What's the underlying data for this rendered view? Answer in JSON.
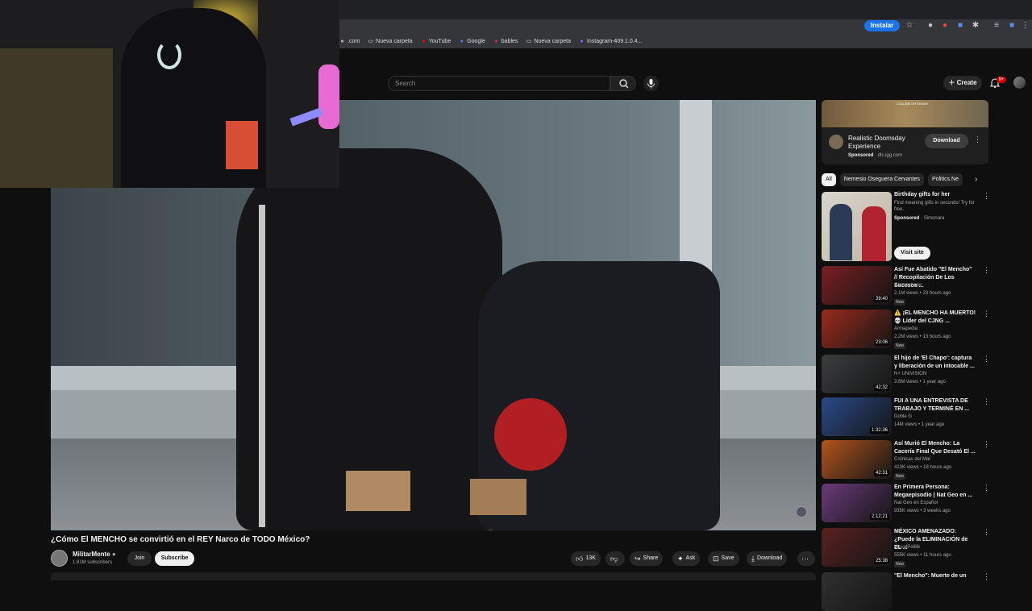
{
  "browser": {
    "install_label": "Instalar",
    "bookmarks": [
      {
        "label": ".com",
        "icon": "link-icon",
        "color": "#bbbbbb"
      },
      {
        "label": "Nueva carpeta",
        "icon": "folder-icon",
        "color": "#dddddd"
      },
      {
        "label": "YouTube",
        "icon": "youtube-icon",
        "color": "#ff0000"
      },
      {
        "label": "Google",
        "icon": "google-icon",
        "color": "#4285f4"
      },
      {
        "label": "bables",
        "icon": "site-icon",
        "color": "#e0245e"
      },
      {
        "label": "Nueva carpeta",
        "icon": "folder-icon",
        "color": "#dddddd"
      },
      {
        "label": "Instagram-409.1.0.4...",
        "icon": "instagram-icon",
        "color": "#8a5cf6"
      }
    ]
  },
  "masthead": {
    "search_placeholder": "Search",
    "create_label": "Create",
    "notification_badge": "9+"
  },
  "video": {
    "title": "¿Cómo El MENCHO se convirtió en el REY Narco de TODO México?",
    "channel": "MilitarMente",
    "subscribers": "1.81M subscribers",
    "join_label": "Join",
    "subscribe_label": "Subscribe",
    "likes": "13K",
    "share_label": "Share",
    "ask_label": "Ask",
    "save_label": "Save",
    "download_label": "Download"
  },
  "ad": {
    "banner_text": "COLLIDE OR KNOW!",
    "title": "Realistic Doomsday Experience",
    "sponsored": "Sponsored",
    "domain": "dls.igg.com",
    "download_label": "Download"
  },
  "chips": [
    "All",
    "Nemesio Oseguera Cervantes",
    "Politics Ne"
  ],
  "sponsored_rec": {
    "title": "Birthday gifts for her",
    "desc": "Find meaning gifts in seconds! Try for free.",
    "sponsored": "Sponsored",
    "advertiser": "Simonara",
    "visit_label": "Visit site"
  },
  "recommendations": [
    {
      "title": "Así Fue Abatido \"El Mencho\" // Recopilación De Los Sucesos ...",
      "channel": "Carmochepe",
      "stats": "2.1M views • 23 hours ago",
      "badge": "New",
      "duration": "39:40",
      "thumb_color": "#7a1e22"
    },
    {
      "title": "⚠️ ¡EL MENCHO HA MUERTO! 💀 Líder del CJNG ...",
      "channel": "Armapedia",
      "stats": "2.2M views • 13 hours ago",
      "badge": "New",
      "duration": "23:06",
      "thumb_color": "#9b2a1e"
    },
    {
      "title": "El hijo de 'El Chapo': captura y liberación de un intocable ...",
      "channel": "N+ UNIVISION",
      "stats": "3.6M views • 1 year ago",
      "badge": "",
      "duration": "42:32",
      "thumb_color": "#3a3d3f"
    },
    {
      "title": "FUI A UNA ENTREVISTA DE TRABAJO Y TERMINÉ EN ...",
      "channel": "Doble G",
      "stats": "14M views • 1 year ago",
      "badge": "",
      "duration": "1:32:36",
      "thumb_color": "#2a4a8a"
    },
    {
      "title": "Así Murió El Mencho: La Cacería Final Que Desató El ...",
      "channel": "Crónicas del Mal",
      "stats": "413K views • 18 hours ago",
      "badge": "New",
      "duration": "42:31",
      "thumb_color": "#b3541e"
    },
    {
      "title": "En Primera Persona: Megaepisodio | Nat Geo en ...",
      "channel": "Nat Geo en Español",
      "stats": "935K views • 3 weeks ago",
      "badge": "",
      "duration": "2:12:21",
      "thumb_color": "#6a3a7a"
    },
    {
      "title": "MÉXICO AMENAZADO: ¿Puede la ELIMINACIÓN de EL ...",
      "channel": "VisualPolitik",
      "stats": "555K views • 11 hours ago",
      "badge": "New",
      "duration": "25:38",
      "thumb_color": "#5a2020"
    },
    {
      "title": "\"El Mencho\": Muerte de un",
      "channel": "",
      "stats": "",
      "badge": "",
      "duration": "",
      "thumb_color": "#303030"
    }
  ]
}
